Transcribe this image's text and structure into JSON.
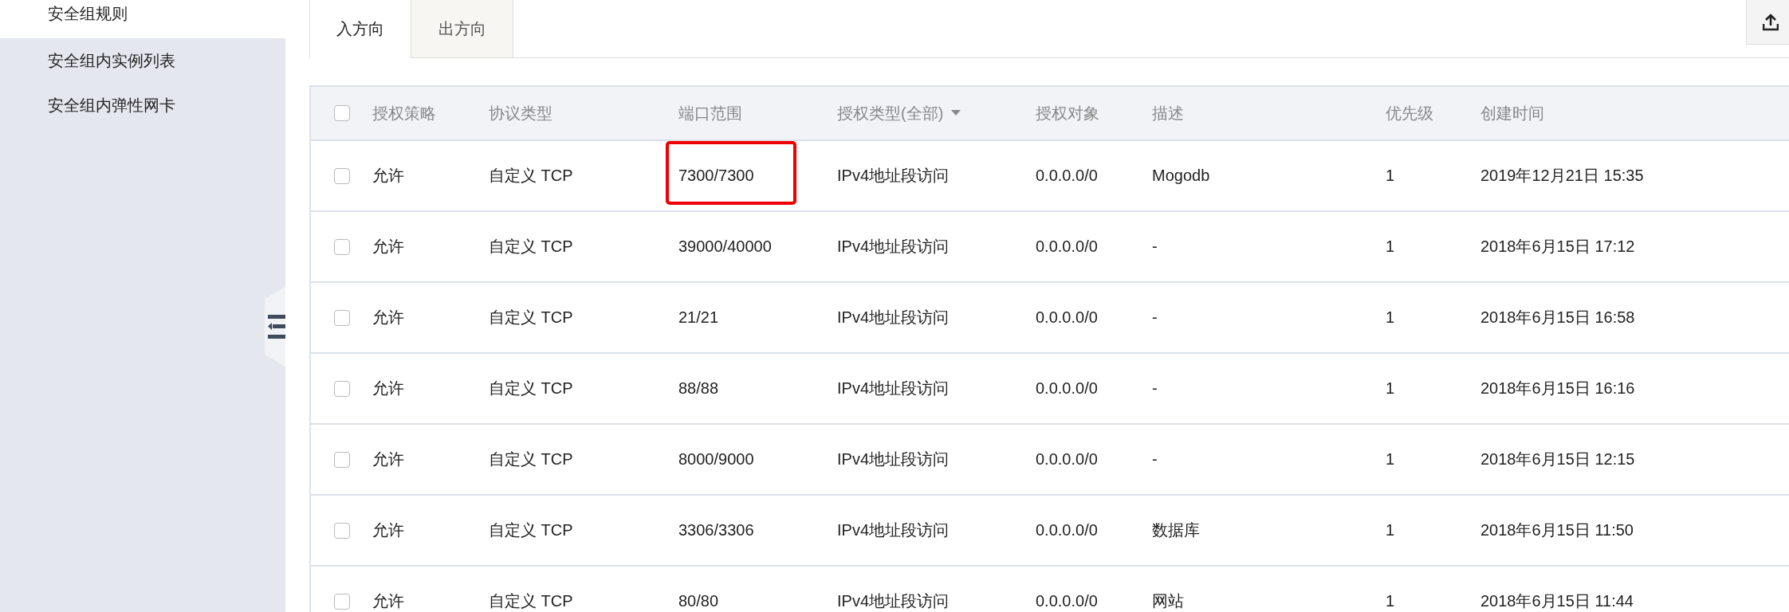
{
  "sidebar": {
    "items": [
      {
        "label": "安全组规则",
        "selected": true
      },
      {
        "label": "安全组内实例列表",
        "selected": false
      },
      {
        "label": "安全组内弹性网卡",
        "selected": false
      }
    ]
  },
  "tabs": [
    {
      "label": "入方向",
      "selected": true
    },
    {
      "label": "出方向",
      "selected": false
    }
  ],
  "table": {
    "columns": [
      "授权策略",
      "协议类型",
      "端口范围",
      "授权类型(全部)",
      "授权对象",
      "描述",
      "优先级",
      "创建时间"
    ],
    "header_checked": false,
    "rows": [
      {
        "checked": false,
        "cells": [
          "允许",
          "自定义 TCP",
          "7300/7300",
          "IPv4地址段访问",
          "0.0.0.0/0",
          "Mogodb",
          "1",
          "2019年12月21日 15:35"
        ],
        "port_highlighted": true
      },
      {
        "checked": false,
        "cells": [
          "允许",
          "自定义 TCP",
          "39000/40000",
          "IPv4地址段访问",
          "0.0.0.0/0",
          "-",
          "1",
          "2018年6月15日 17:12"
        ]
      },
      {
        "checked": false,
        "cells": [
          "允许",
          "自定义 TCP",
          "21/21",
          "IPv4地址段访问",
          "0.0.0.0/0",
          "-",
          "1",
          "2018年6月15日 16:58"
        ]
      },
      {
        "checked": false,
        "cells": [
          "允许",
          "自定义 TCP",
          "88/88",
          "IPv4地址段访问",
          "0.0.0.0/0",
          "-",
          "1",
          "2018年6月15日 16:16"
        ]
      },
      {
        "checked": false,
        "cells": [
          "允许",
          "自定义 TCP",
          "8000/9000",
          "IPv4地址段访问",
          "0.0.0.0/0",
          "-",
          "1",
          "2018年6月15日 12:15"
        ]
      },
      {
        "checked": false,
        "cells": [
          "允许",
          "自定义 TCP",
          "3306/3306",
          "IPv4地址段访问",
          "0.0.0.0/0",
          "数据库",
          "1",
          "2018年6月15日 11:50"
        ]
      },
      {
        "checked": false,
        "cells": [
          "允许",
          "自定义 TCP",
          "80/80",
          "IPv4地址段访问",
          "0.0.0.0/0",
          "网站",
          "1",
          "2018年6月15日 11:44"
        ]
      }
    ]
  }
}
